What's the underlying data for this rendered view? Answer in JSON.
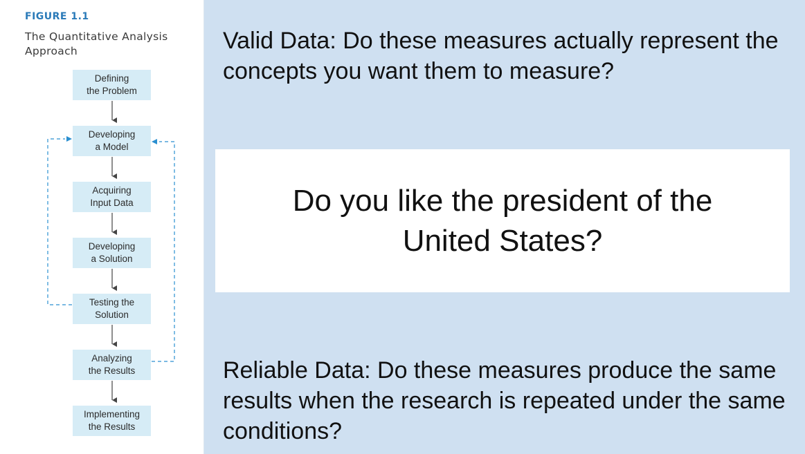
{
  "figure": {
    "label": "FIGURE 1.1",
    "caption": "The Quantitative Analysis Approach",
    "steps": [
      "Defining\nthe Problem",
      "Developing\na Model",
      "Acquiring\nInput Data",
      "Developing\na Solution",
      "Testing the\nSolution",
      "Analyzing\nthe Results",
      "Implementing\nthe Results"
    ],
    "colors": {
      "step_fill": "#d6ecf6",
      "arrow": "#444444",
      "feedback_arrow": "#2a8fd0",
      "label": "#2a7ab8"
    }
  },
  "content": {
    "valid_text": "Valid Data: Do these measures actually represent the concepts you want them to measure?",
    "question": "Do you like the president of the United States?",
    "reliable_text": "Reliable Data: Do these measures produce the same results when the research is repeated under the same conditions?"
  },
  "colors": {
    "slide_background": "#cfe0f1",
    "card_background": "#ffffff"
  }
}
